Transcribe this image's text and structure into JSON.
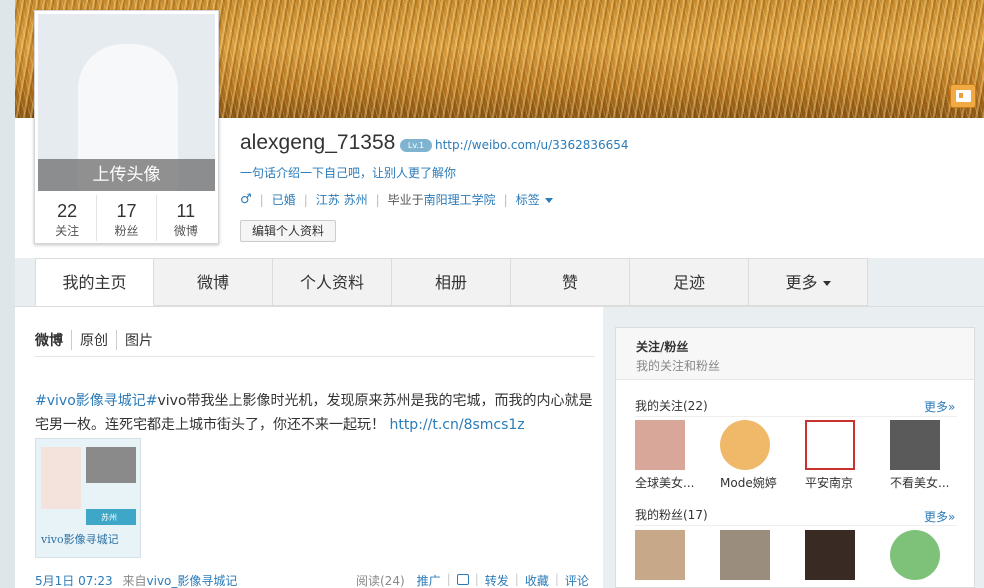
{
  "profile": {
    "username": "alexgeng_71358",
    "level_badge": "Lv.1",
    "url": "http://weibo.com/u/3362836654",
    "intro": "一句话介绍一下自己吧，让别人更了解你",
    "gender_icon": "male-icon",
    "marital": "已婚",
    "location": "江苏 苏州",
    "school_prefix": "毕业于",
    "school": "南阳理工学院",
    "tags_label": "标签",
    "edit_label": "编辑个人资料",
    "upload_avatar": "上传头像",
    "stats": [
      {
        "num": "22",
        "label": "关注"
      },
      {
        "num": "17",
        "label": "粉丝"
      },
      {
        "num": "11",
        "label": "微博"
      }
    ]
  },
  "tabs": [
    "我的主页",
    "微博",
    "个人资料",
    "相册",
    "赞",
    "足迹",
    "更多"
  ],
  "feed": {
    "subtabs": [
      "微博",
      "原创",
      "图片"
    ],
    "post": {
      "tag": "#vivo影像寻城记#",
      "text": "vivo带我坐上影像时光机，发现原来苏州是我的宅城，而我的内心就是宅男一枚。连死宅都走上城市街头了，你还不来一起玩！",
      "link": "http://t.cn/8smcs1z",
      "image_caption": "vivo影像寻城记",
      "image_city": "苏州",
      "date": "5月1日 07:23",
      "source_prefix": "来自",
      "source": "vivo_影像寻城记",
      "read": "阅读(24)",
      "promote": "推广",
      "forward": "转发",
      "favorite": "收藏",
      "comment": "评论"
    }
  },
  "side": {
    "title": "关注/粉丝",
    "subtitle": "我的关注和粉丝",
    "following_title": "我的关注(22)",
    "followers_title": "我的粉丝(17)",
    "more_label": "更多»",
    "following": [
      {
        "name": "全球美女...",
        "color": "#d9a79a"
      },
      {
        "name": "Mode婉婷",
        "color": "#f0b96a"
      },
      {
        "name": "平安南京",
        "color": "#c8312e"
      },
      {
        "name": "不看美女...",
        "color": "#5a5a5a"
      }
    ],
    "followers": [
      {
        "name": "",
        "color": "#c7a98a"
      },
      {
        "name": "",
        "color": "#9b8d7e"
      },
      {
        "name": "",
        "color": "#3a2a24"
      },
      {
        "name": "",
        "color": "#7ec27a"
      }
    ]
  }
}
